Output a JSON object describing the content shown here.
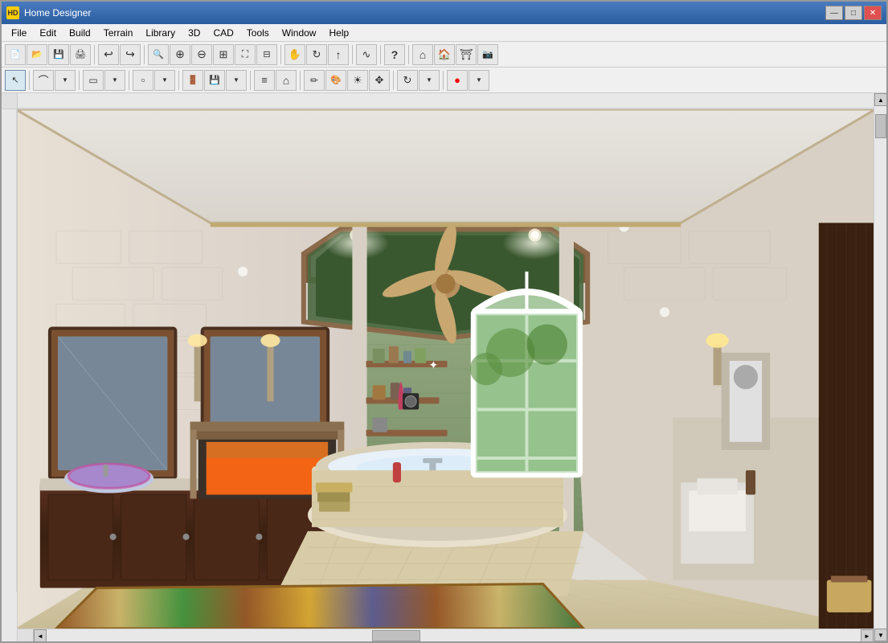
{
  "window": {
    "title": "Home Designer",
    "icon_label": "HD"
  },
  "title_bar": {
    "title": "Home Designer",
    "minimize_label": "—",
    "maximize_label": "□",
    "close_label": "✕"
  },
  "menu": {
    "items": [
      "File",
      "Edit",
      "Build",
      "Terrain",
      "Library",
      "3D",
      "CAD",
      "Tools",
      "Window",
      "Help"
    ]
  },
  "toolbar1": {
    "buttons": [
      {
        "name": "new",
        "icon": "📄",
        "label": "New"
      },
      {
        "name": "open",
        "icon": "📂",
        "label": "Open"
      },
      {
        "name": "save",
        "icon": "💾",
        "label": "Save"
      },
      {
        "name": "print",
        "icon": "🖨",
        "label": "Print"
      },
      {
        "name": "sep1",
        "type": "separator"
      },
      {
        "name": "undo",
        "icon": "↩",
        "label": "Undo"
      },
      {
        "name": "redo",
        "icon": "↪",
        "label": "Redo"
      },
      {
        "name": "sep2",
        "type": "separator"
      },
      {
        "name": "zoom-zoom",
        "icon": "🔍",
        "label": "Zoom"
      },
      {
        "name": "zoom-in",
        "icon": "⊕",
        "label": "Zoom In"
      },
      {
        "name": "zoom-out",
        "icon": "⊖",
        "label": "Zoom Out"
      },
      {
        "name": "zoom-fit",
        "icon": "⊞",
        "label": "Fit"
      },
      {
        "name": "zoom-ext",
        "icon": "⛶",
        "label": "Extents"
      },
      {
        "name": "sep3",
        "type": "separator"
      },
      {
        "name": "pan",
        "icon": "✋",
        "label": "Pan"
      },
      {
        "name": "orbit",
        "icon": "↻",
        "label": "Orbit"
      },
      {
        "name": "arrow-up",
        "icon": "↑",
        "label": "Up"
      },
      {
        "name": "sep4",
        "type": "separator"
      },
      {
        "name": "sym",
        "icon": "∿",
        "label": "Symbol"
      },
      {
        "name": "sep5",
        "type": "separator"
      },
      {
        "name": "help",
        "icon": "?",
        "label": "Help"
      },
      {
        "name": "sep6",
        "type": "separator"
      },
      {
        "name": "house",
        "icon": "⌂",
        "label": "House"
      },
      {
        "name": "house2",
        "icon": "⌂",
        "label": "House2"
      },
      {
        "name": "camera",
        "icon": "📷",
        "label": "Camera"
      }
    ]
  },
  "toolbar2": {
    "buttons": [
      {
        "name": "select",
        "icon": "↖",
        "label": "Select"
      },
      {
        "name": "sep1",
        "type": "separator"
      },
      {
        "name": "arc",
        "icon": "⌒",
        "label": "Arc"
      },
      {
        "name": "sep2",
        "type": "separator"
      },
      {
        "name": "wall",
        "icon": "▭",
        "label": "Wall"
      },
      {
        "name": "sep3",
        "type": "separator"
      },
      {
        "name": "cabinet",
        "icon": "▫",
        "label": "Cabinet"
      },
      {
        "name": "sep4",
        "type": "separator"
      },
      {
        "name": "door-grp",
        "icon": "🚪",
        "label": "Door"
      },
      {
        "name": "save2",
        "icon": "💾",
        "label": "Save2"
      },
      {
        "name": "sep5",
        "type": "separator"
      },
      {
        "name": "stair",
        "icon": "≡",
        "label": "Stair"
      },
      {
        "name": "roof",
        "icon": "⌂",
        "label": "Roof"
      },
      {
        "name": "sep6",
        "type": "separator"
      },
      {
        "name": "pencil",
        "icon": "✏",
        "label": "Pencil"
      },
      {
        "name": "paint",
        "icon": "🎨",
        "label": "Paint"
      },
      {
        "name": "sun",
        "icon": "☀",
        "label": "Sun"
      },
      {
        "name": "cursor2",
        "icon": "✥",
        "label": "Move"
      },
      {
        "name": "sep7",
        "type": "separator"
      },
      {
        "name": "rotate",
        "icon": "↻",
        "label": "Rotate"
      },
      {
        "name": "sep8",
        "type": "separator"
      },
      {
        "name": "rec",
        "icon": "●",
        "label": "Record"
      }
    ]
  },
  "scrollbar": {
    "up_arrow": "▲",
    "down_arrow": "▼",
    "left_arrow": "◄",
    "right_arrow": "►"
  },
  "status_bar": {
    "text": ""
  }
}
